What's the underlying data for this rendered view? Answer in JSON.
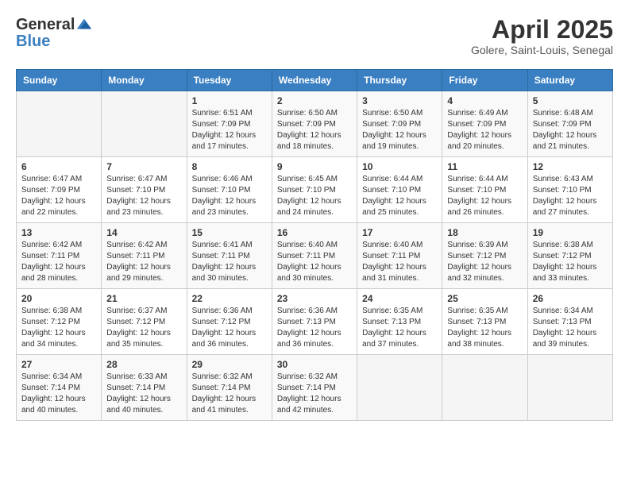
{
  "logo": {
    "general": "General",
    "blue": "Blue"
  },
  "title": "April 2025",
  "subtitle": "Golere, Saint-Louis, Senegal",
  "weekdays": [
    "Sunday",
    "Monday",
    "Tuesday",
    "Wednesday",
    "Thursday",
    "Friday",
    "Saturday"
  ],
  "weeks": [
    [
      {
        "day": "",
        "info": ""
      },
      {
        "day": "",
        "info": ""
      },
      {
        "day": "1",
        "info": "Sunrise: 6:51 AM\nSunset: 7:09 PM\nDaylight: 12 hours and 17 minutes."
      },
      {
        "day": "2",
        "info": "Sunrise: 6:50 AM\nSunset: 7:09 PM\nDaylight: 12 hours and 18 minutes."
      },
      {
        "day": "3",
        "info": "Sunrise: 6:50 AM\nSunset: 7:09 PM\nDaylight: 12 hours and 19 minutes."
      },
      {
        "day": "4",
        "info": "Sunrise: 6:49 AM\nSunset: 7:09 PM\nDaylight: 12 hours and 20 minutes."
      },
      {
        "day": "5",
        "info": "Sunrise: 6:48 AM\nSunset: 7:09 PM\nDaylight: 12 hours and 21 minutes."
      }
    ],
    [
      {
        "day": "6",
        "info": "Sunrise: 6:47 AM\nSunset: 7:09 PM\nDaylight: 12 hours and 22 minutes."
      },
      {
        "day": "7",
        "info": "Sunrise: 6:47 AM\nSunset: 7:10 PM\nDaylight: 12 hours and 23 minutes."
      },
      {
        "day": "8",
        "info": "Sunrise: 6:46 AM\nSunset: 7:10 PM\nDaylight: 12 hours and 23 minutes."
      },
      {
        "day": "9",
        "info": "Sunrise: 6:45 AM\nSunset: 7:10 PM\nDaylight: 12 hours and 24 minutes."
      },
      {
        "day": "10",
        "info": "Sunrise: 6:44 AM\nSunset: 7:10 PM\nDaylight: 12 hours and 25 minutes."
      },
      {
        "day": "11",
        "info": "Sunrise: 6:44 AM\nSunset: 7:10 PM\nDaylight: 12 hours and 26 minutes."
      },
      {
        "day": "12",
        "info": "Sunrise: 6:43 AM\nSunset: 7:10 PM\nDaylight: 12 hours and 27 minutes."
      }
    ],
    [
      {
        "day": "13",
        "info": "Sunrise: 6:42 AM\nSunset: 7:11 PM\nDaylight: 12 hours and 28 minutes."
      },
      {
        "day": "14",
        "info": "Sunrise: 6:42 AM\nSunset: 7:11 PM\nDaylight: 12 hours and 29 minutes."
      },
      {
        "day": "15",
        "info": "Sunrise: 6:41 AM\nSunset: 7:11 PM\nDaylight: 12 hours and 30 minutes."
      },
      {
        "day": "16",
        "info": "Sunrise: 6:40 AM\nSunset: 7:11 PM\nDaylight: 12 hours and 30 minutes."
      },
      {
        "day": "17",
        "info": "Sunrise: 6:40 AM\nSunset: 7:11 PM\nDaylight: 12 hours and 31 minutes."
      },
      {
        "day": "18",
        "info": "Sunrise: 6:39 AM\nSunset: 7:12 PM\nDaylight: 12 hours and 32 minutes."
      },
      {
        "day": "19",
        "info": "Sunrise: 6:38 AM\nSunset: 7:12 PM\nDaylight: 12 hours and 33 minutes."
      }
    ],
    [
      {
        "day": "20",
        "info": "Sunrise: 6:38 AM\nSunset: 7:12 PM\nDaylight: 12 hours and 34 minutes."
      },
      {
        "day": "21",
        "info": "Sunrise: 6:37 AM\nSunset: 7:12 PM\nDaylight: 12 hours and 35 minutes."
      },
      {
        "day": "22",
        "info": "Sunrise: 6:36 AM\nSunset: 7:12 PM\nDaylight: 12 hours and 36 minutes."
      },
      {
        "day": "23",
        "info": "Sunrise: 6:36 AM\nSunset: 7:13 PM\nDaylight: 12 hours and 36 minutes."
      },
      {
        "day": "24",
        "info": "Sunrise: 6:35 AM\nSunset: 7:13 PM\nDaylight: 12 hours and 37 minutes."
      },
      {
        "day": "25",
        "info": "Sunrise: 6:35 AM\nSunset: 7:13 PM\nDaylight: 12 hours and 38 minutes."
      },
      {
        "day": "26",
        "info": "Sunrise: 6:34 AM\nSunset: 7:13 PM\nDaylight: 12 hours and 39 minutes."
      }
    ],
    [
      {
        "day": "27",
        "info": "Sunrise: 6:34 AM\nSunset: 7:14 PM\nDaylight: 12 hours and 40 minutes."
      },
      {
        "day": "28",
        "info": "Sunrise: 6:33 AM\nSunset: 7:14 PM\nDaylight: 12 hours and 40 minutes."
      },
      {
        "day": "29",
        "info": "Sunrise: 6:32 AM\nSunset: 7:14 PM\nDaylight: 12 hours and 41 minutes."
      },
      {
        "day": "30",
        "info": "Sunrise: 6:32 AM\nSunset: 7:14 PM\nDaylight: 12 hours and 42 minutes."
      },
      {
        "day": "",
        "info": ""
      },
      {
        "day": "",
        "info": ""
      },
      {
        "day": "",
        "info": ""
      }
    ]
  ]
}
